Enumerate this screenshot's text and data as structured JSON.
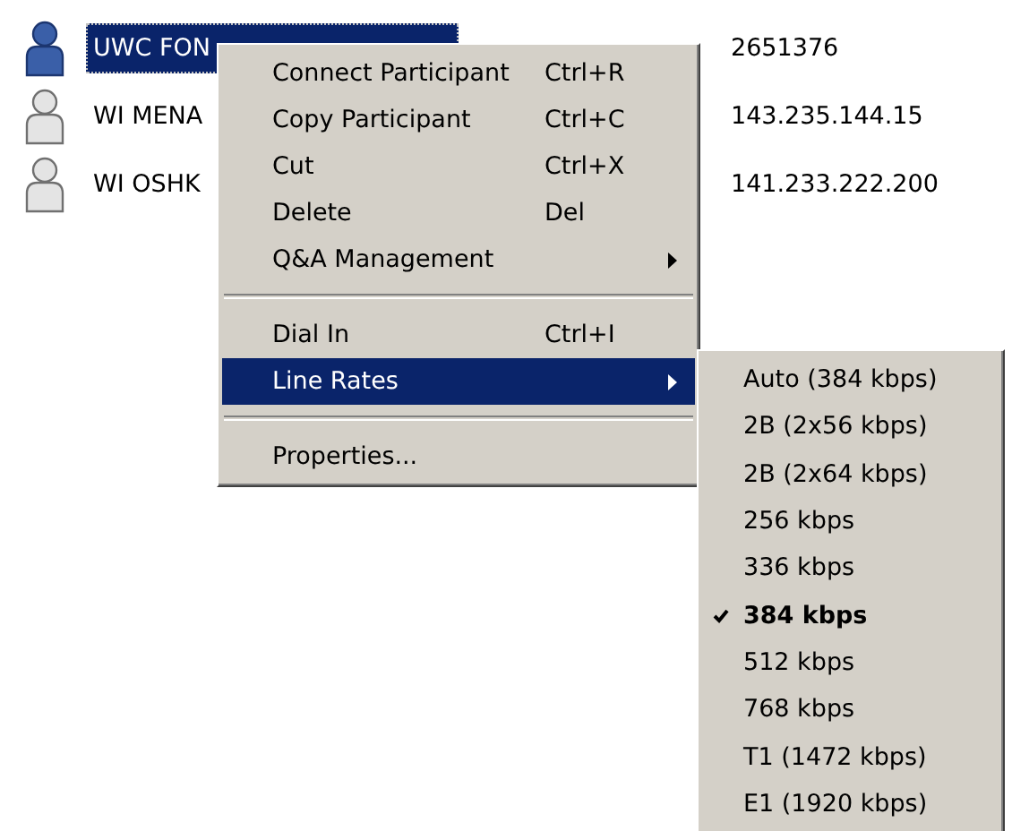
{
  "participants": [
    {
      "name": "UWC FON",
      "value": "2651376",
      "selected": true
    },
    {
      "name": "WI MENA",
      "value": "143.235.144.15",
      "selected": false
    },
    {
      "name": "WI OSHK",
      "value": "141.233.222.200",
      "selected": false
    }
  ],
  "context_menu": [
    {
      "kind": "item",
      "label": "Connect Participant",
      "shortcut": "Ctrl+R",
      "submenu": false,
      "selected": false
    },
    {
      "kind": "item",
      "label": "Copy Participant",
      "shortcut": "Ctrl+C",
      "submenu": false,
      "selected": false
    },
    {
      "kind": "item",
      "label": "Cut",
      "shortcut": "Ctrl+X",
      "submenu": false,
      "selected": false
    },
    {
      "kind": "item",
      "label": "Delete",
      "shortcut": "Del",
      "submenu": false,
      "selected": false
    },
    {
      "kind": "item",
      "label": "Q&A Management",
      "submenu": true,
      "selected": false
    },
    {
      "kind": "separator"
    },
    {
      "kind": "item",
      "label": "Dial In",
      "shortcut": "Ctrl+I",
      "submenu": false,
      "selected": false
    },
    {
      "kind": "item",
      "label": "Line Rates",
      "submenu": true,
      "selected": true
    },
    {
      "kind": "separator"
    },
    {
      "kind": "item",
      "label": "Properties...",
      "submenu": false,
      "selected": false
    }
  ],
  "line_rates_submenu": [
    {
      "label": "Auto (384 kbps)",
      "checked": false
    },
    {
      "label": "2B (2x56 kbps)",
      "checked": false
    },
    {
      "label": "2B (2x64 kbps)",
      "checked": false
    },
    {
      "label": "256 kbps",
      "checked": false
    },
    {
      "label": "336 kbps",
      "checked": false
    },
    {
      "label": "384 kbps",
      "checked": true
    },
    {
      "label": "512 kbps",
      "checked": false
    },
    {
      "label": "768 kbps",
      "checked": false
    },
    {
      "label": "T1 (1472 kbps)",
      "checked": false
    },
    {
      "label": "E1 (1920 kbps)",
      "checked": false
    }
  ]
}
